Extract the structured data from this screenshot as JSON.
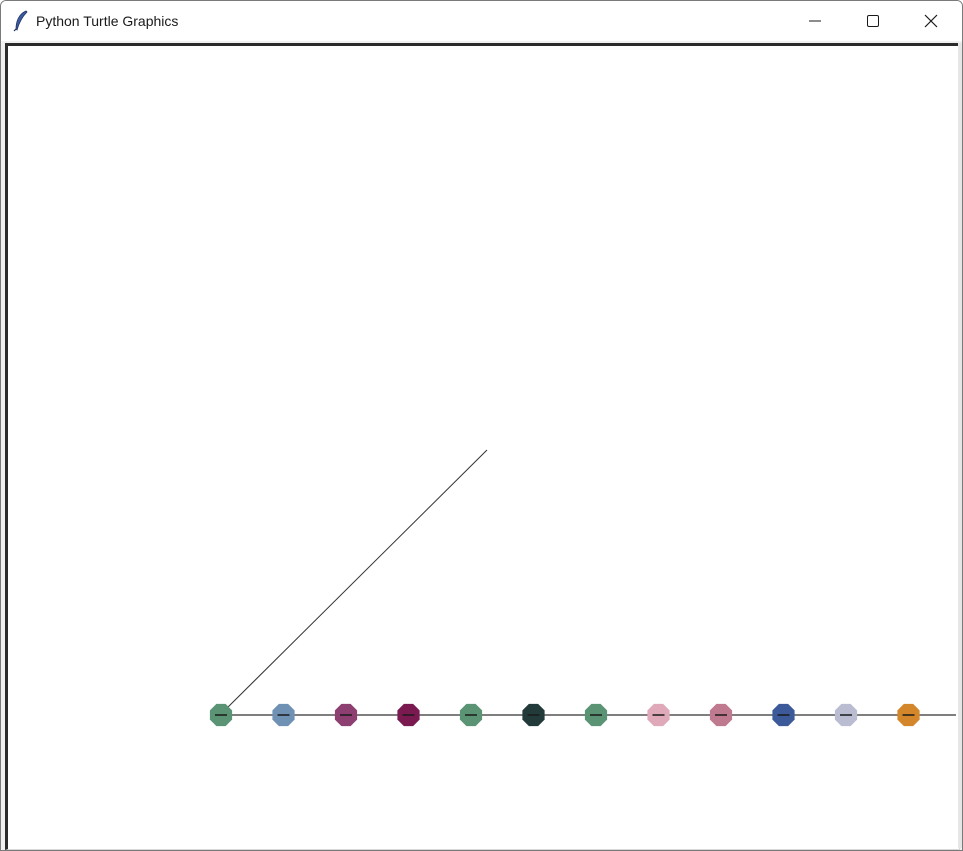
{
  "window": {
    "title": "Python Turtle Graphics",
    "icon": "feather-icon",
    "controls": [
      "minimize-icon",
      "maximize-icon",
      "close-icon"
    ]
  },
  "drawing": {
    "line_color": "#333333",
    "dot_colors": [
      "#5a9474",
      "#6f92b4",
      "#8c3f70",
      "#7a1a50",
      "#5a9474",
      "#233a3a",
      "#5a9474",
      "#e0a9ba",
      "#c07a90",
      "#3c5a9a",
      "#babdd2",
      "#d4862a"
    ]
  }
}
